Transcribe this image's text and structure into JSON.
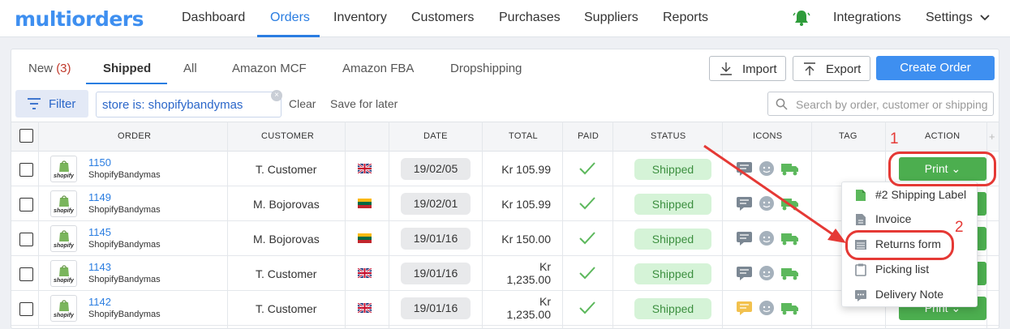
{
  "brand": {
    "logo": "multiorders"
  },
  "nav": {
    "items": [
      "Dashboard",
      "Orders",
      "Inventory",
      "Customers",
      "Purchases",
      "Suppliers",
      "Reports"
    ],
    "active": "Orders",
    "right": {
      "integrations": "Integrations",
      "settings": "Settings"
    }
  },
  "tabs": {
    "new_label": "New",
    "new_count": "(3)",
    "shipped": "Shipped",
    "all": "All",
    "amazon_mcf": "Amazon MCF",
    "amazon_fba": "Amazon FBA",
    "dropshipping": "Dropshipping"
  },
  "toolbar": {
    "import": "Import",
    "export": "Export",
    "create_order": "Create Order"
  },
  "filter": {
    "button": "Filter",
    "chip": "store is: shopifybandymas",
    "clear": "Clear",
    "save": "Save for later",
    "search_placeholder": "Search by order, customer or shipping"
  },
  "table": {
    "headers": {
      "order": "ORDER",
      "customer": "CUSTOMER",
      "date": "DATE",
      "total": "TOTAL",
      "paid": "PAID",
      "status": "STATUS",
      "icons": "ICONS",
      "tag": "TAG",
      "action": "ACTION"
    },
    "rows": [
      {
        "order": "1150",
        "store": "ShopifyBandymas",
        "customer": "T. Customer",
        "flag": "GB",
        "date": "19/02/05",
        "total_a": "Kr 105.99",
        "total_b": "",
        "status": "Shipped",
        "message_icon_color": "#7b8793"
      },
      {
        "order": "1149",
        "store": "ShopifyBandymas",
        "customer": "M. Bojorovas",
        "flag": "LT",
        "date": "19/02/01",
        "total_a": "Kr 105.99",
        "total_b": "",
        "status": "Shipped",
        "message_icon_color": "#7b8793"
      },
      {
        "order": "1145",
        "store": "ShopifyBandymas",
        "customer": "M. Bojorovas",
        "flag": "LT",
        "date": "19/01/16",
        "total_a": "Kr 150.00",
        "total_b": "",
        "status": "Shipped",
        "message_icon_color": "#7b8793"
      },
      {
        "order": "1143",
        "store": "ShopifyBandymas",
        "customer": "T. Customer",
        "flag": "GB",
        "date": "19/01/16",
        "total_a": "Kr",
        "total_b": "1,235.00",
        "status": "Shipped",
        "message_icon_color": "#7b8793"
      },
      {
        "order": "1142",
        "store": "ShopifyBandymas",
        "customer": "T. Customer",
        "flag": "GB",
        "date": "19/01/16",
        "total_a": "Kr",
        "total_b": "1,235.00",
        "status": "Shipped",
        "message_icon_color": "#f2c14e"
      }
    ],
    "shopify_badge": "shopify",
    "print_label": "Print"
  },
  "dropdown": {
    "items": [
      "#2 Shipping Label",
      "Invoice",
      "Returns form",
      "Picking list",
      "Delivery Note"
    ]
  },
  "annotations": {
    "step1": "1",
    "step2": "2"
  },
  "colors": {
    "accent": "#2a7de1",
    "primary": "#3e8ff0",
    "success": "#4cae4f",
    "annotation": "#e53935"
  }
}
